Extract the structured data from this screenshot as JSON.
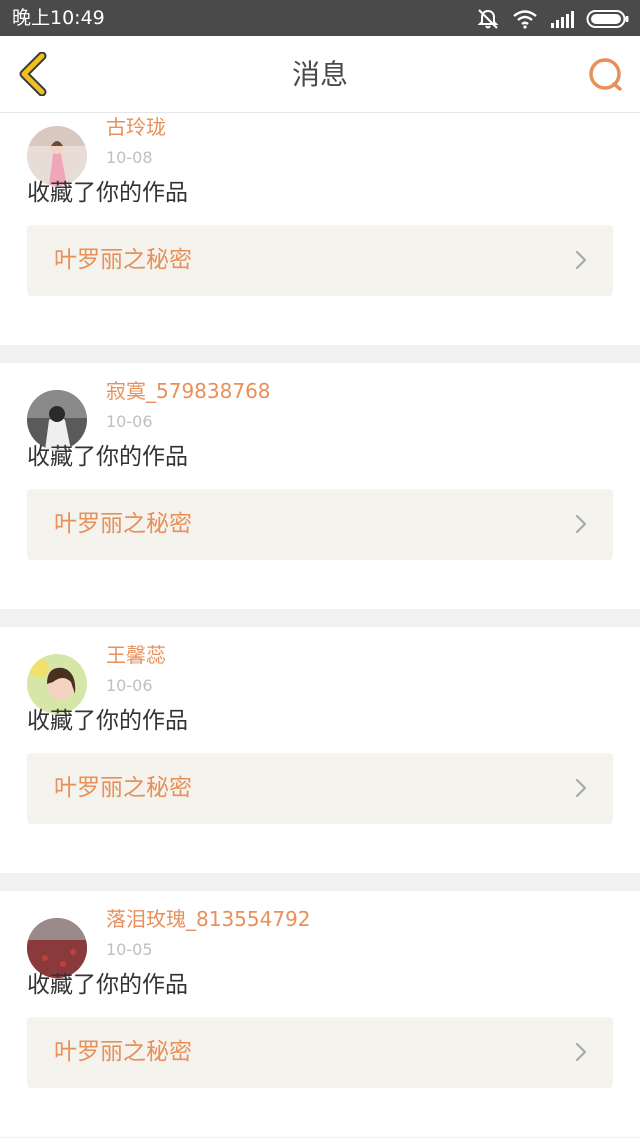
{
  "status_bar": {
    "time": "晚上10:49",
    "icons": [
      "mute-icon",
      "wifi-icon",
      "signal-icon",
      "battery-icon"
    ]
  },
  "header": {
    "title": "消息",
    "back_icon": "chevron-left-icon",
    "search_icon": "search-icon",
    "accent_color": "#e8905a"
  },
  "messages": [
    {
      "username": "古玲珑",
      "date": "10-08",
      "action": "收藏了你的作品",
      "work_title": "叶罗丽之秘密"
    },
    {
      "username": "寂寞_579838768",
      "date": "10-06",
      "action": "收藏了你的作品",
      "work_title": "叶罗丽之秘密"
    },
    {
      "username": "王馨蕊",
      "date": "10-06",
      "action": "收藏了你的作品",
      "work_title": "叶罗丽之秘密"
    },
    {
      "username": "落泪玫瑰_813554792",
      "date": "10-05",
      "action": "收藏了你的作品",
      "work_title": "叶罗丽之秘密"
    }
  ]
}
